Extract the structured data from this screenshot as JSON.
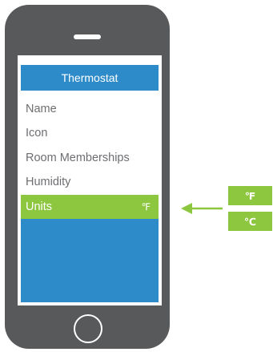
{
  "screen": {
    "title": "Thermostat",
    "menu_items": [
      {
        "label": "Name"
      },
      {
        "label": "Icon"
      },
      {
        "label": "Room Memberships"
      },
      {
        "label": "Humidity"
      }
    ],
    "selected_item": {
      "label": "Units",
      "value": "℉"
    }
  },
  "unit_options": [
    {
      "label": "℉"
    },
    {
      "label": "℃"
    }
  ],
  "icons": {
    "pointer": "arrow-left-icon"
  },
  "colors": {
    "phone_body": "#58595b",
    "title_bar": "#2e8bc9",
    "selected_row": "#8dc63f",
    "menu_text": "#6d6e71",
    "unit_buttons": "#8dc63f"
  }
}
